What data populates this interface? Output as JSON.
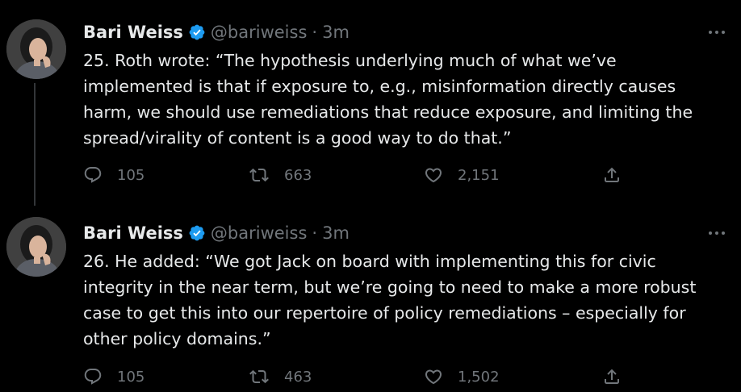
{
  "tweets": [
    {
      "name": "Bari Weiss",
      "handle": "@bariweiss",
      "time": "3m",
      "text": "25. Roth wrote: “The hypothesis underlying much of what we’ve implemented is that if exposure to, e.g., misinformation directly causes harm, we should use remediations that reduce exposure, and limiting the spread/virality of content is a good way to do that.”",
      "replies": "105",
      "retweets": "663",
      "likes": "2,151"
    },
    {
      "name": "Bari Weiss",
      "handle": "@bariweiss",
      "time": "3m",
      "text": "26. He added: “We got Jack on board with implementing this for civic integrity in the near term, but we’re going to need to make a more robust case to get this into our repertoire of policy remediations – especially for other policy domains.”",
      "replies": "105",
      "retweets": "463",
      "likes": "1,502"
    }
  ],
  "ui": {
    "separator": "·"
  },
  "colors": {
    "background": "#000000",
    "text": "#e7e9ea",
    "muted": "#71767b",
    "verified": "#1d9bf0",
    "thread_line": "#333639"
  }
}
